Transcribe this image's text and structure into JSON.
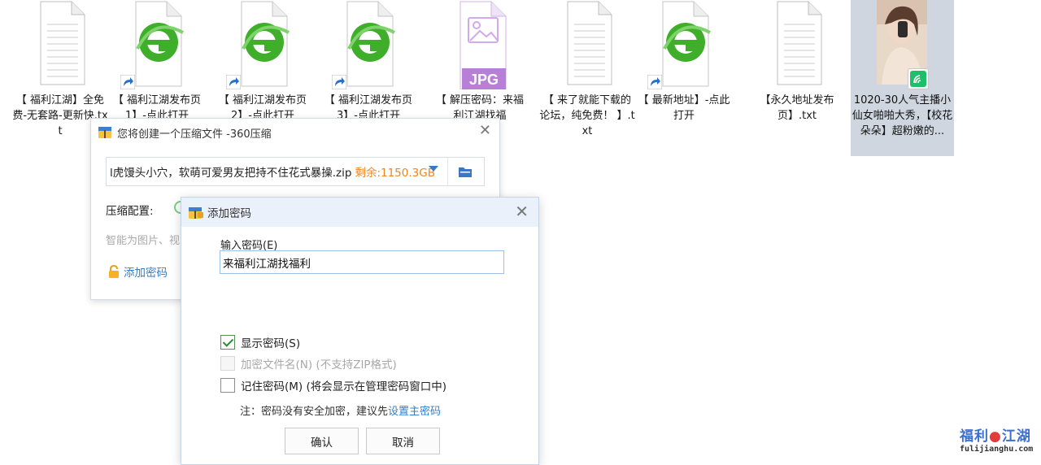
{
  "desktop_files": [
    {
      "label": "【 福利江湖】全免费-无套路-更新快.txt",
      "kind": "txt"
    },
    {
      "label": "【 福利江湖发布页1】-点此打开",
      "kind": "ie"
    },
    {
      "label": "【 福利江湖发布页2】-点此打开",
      "kind": "ie"
    },
    {
      "label": "【 福利江湖发布页3】-点此打开",
      "kind": "ie"
    },
    {
      "label": "【 解压密码：来福利江湖找福",
      "kind": "jpg",
      "thumb_text": "JPG"
    },
    {
      "label": "【 来了就能下载的论坛，纯免费！ 】.txt",
      "kind": "txt"
    },
    {
      "label": "【 最新地址】-点此打开",
      "kind": "ie"
    },
    {
      "label": "【永久地址发布页】.txt",
      "kind": "txt"
    },
    {
      "label": "1020-30人气主播小仙女啪啪大秀，【校花朵朵】超粉嫩的...",
      "kind": "video"
    }
  ],
  "zip_dialog": {
    "title": "您将创建一个压缩文件 -360压缩",
    "file_name": "l虎馒头小穴，软萌可爱男友把持不住花式暴操.zip",
    "free_space": "剩余:1150.3GB",
    "config_label": "压缩配置:",
    "hint": "智能为图片、视",
    "add_password": "添加密码"
  },
  "password_dialog": {
    "title": "添加密码",
    "input_label": "输入密码(E)",
    "password_value": "来福利江湖找福利",
    "show_password": "显示密码(S)",
    "show_password_checked": true,
    "encrypt_filename": "加密文件名(N) (不支持ZIP格式)",
    "encrypt_filename_disabled": true,
    "remember_password": "记住密码(M) (将会显示在管理密码窗口中)",
    "remember_password_checked": false,
    "note_prefix": "注：密码没有安全加密，建议先",
    "note_link": "设置主密码",
    "ok_label": "确认",
    "cancel_label": "取消"
  },
  "watermark": {
    "title_a": "福利",
    "title_b": "江湖",
    "url": "fulijianghu.com"
  },
  "colors": {
    "link": "#2f7fd0",
    "free_space": "#f0841f",
    "ie_green": "#3fae2a",
    "jpg_purple": "#b77fd6"
  }
}
